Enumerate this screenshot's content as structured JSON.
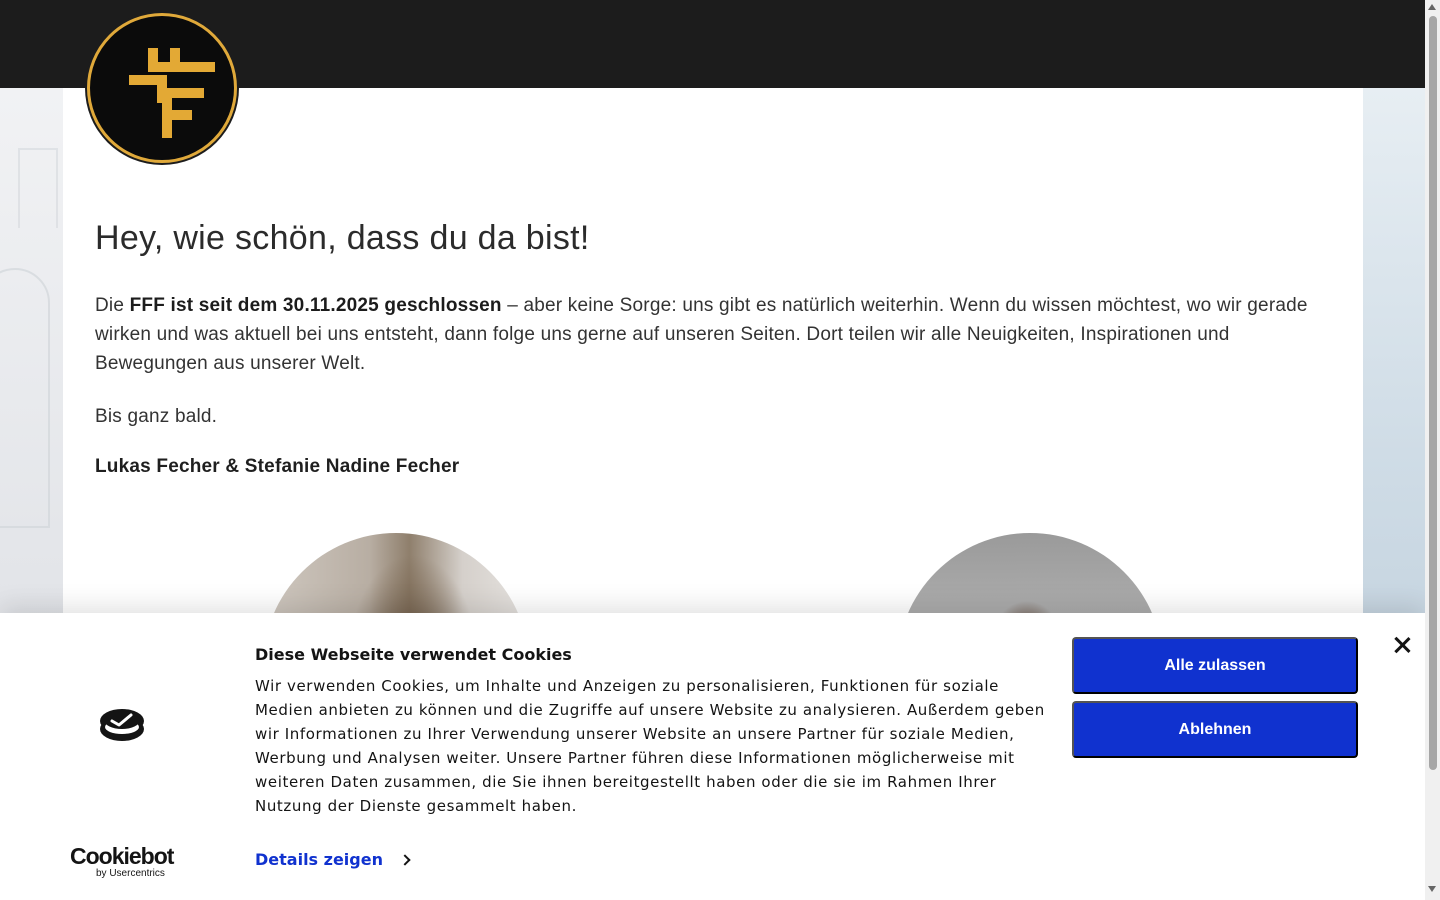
{
  "colors": {
    "topbar": "#1c1c1c",
    "logo_gold": "#e0a93a",
    "cookie_button": "#1032cf"
  },
  "header": {
    "logo_icon": "fff-monogram-logo"
  },
  "main": {
    "headline": "Hey, wie schön, dass du da bist!",
    "intro_prefix": "Die ",
    "intro_bold": "FFF ist seit dem 30.11.2025 geschlossen",
    "intro_rest": " – aber keine Sorge: uns gibt es natürlich weiterhin. Wenn du wissen möchtest, wo wir gerade wirken und was aktuell bei uns entsteht, dann folge uns gerne auf unseren Seiten. Dort teilen wir alle Neuigkeiten, Inspirationen und Bewegungen aus unserer Welt.",
    "farewell": "Bis ganz bald.",
    "signature": "Lukas Fecher & Stefanie Nadine Fecher"
  },
  "cookie_banner": {
    "title": "Diese Webseite verwendet Cookies",
    "text": "Wir verwenden Cookies, um Inhalte und Anzeigen zu personalisieren, Funktionen für soziale Medien anbieten zu können und die Zugriffe auf unsere Website zu analysieren. Außerdem geben wir Informationen zu Ihrer Verwendung unserer Website an unsere Partner für soziale Medien, Werbung und Analysen weiter. Unsere Partner führen diese Informationen möglicherweise mit weiteren Daten zusammen, die Sie ihnen bereitgestellt haben oder die sie im Rahmen Ihrer Nutzung der Dienste gesammelt haben.",
    "details_link": "Details zeigen",
    "allow_all": "Alle zulassen",
    "decline": "Ablehnen",
    "brand_name": "Cookiebot",
    "brand_sub": "by Usercentrics",
    "close_icon": "close-icon",
    "consent_icon": "cookie-consent-icon"
  }
}
